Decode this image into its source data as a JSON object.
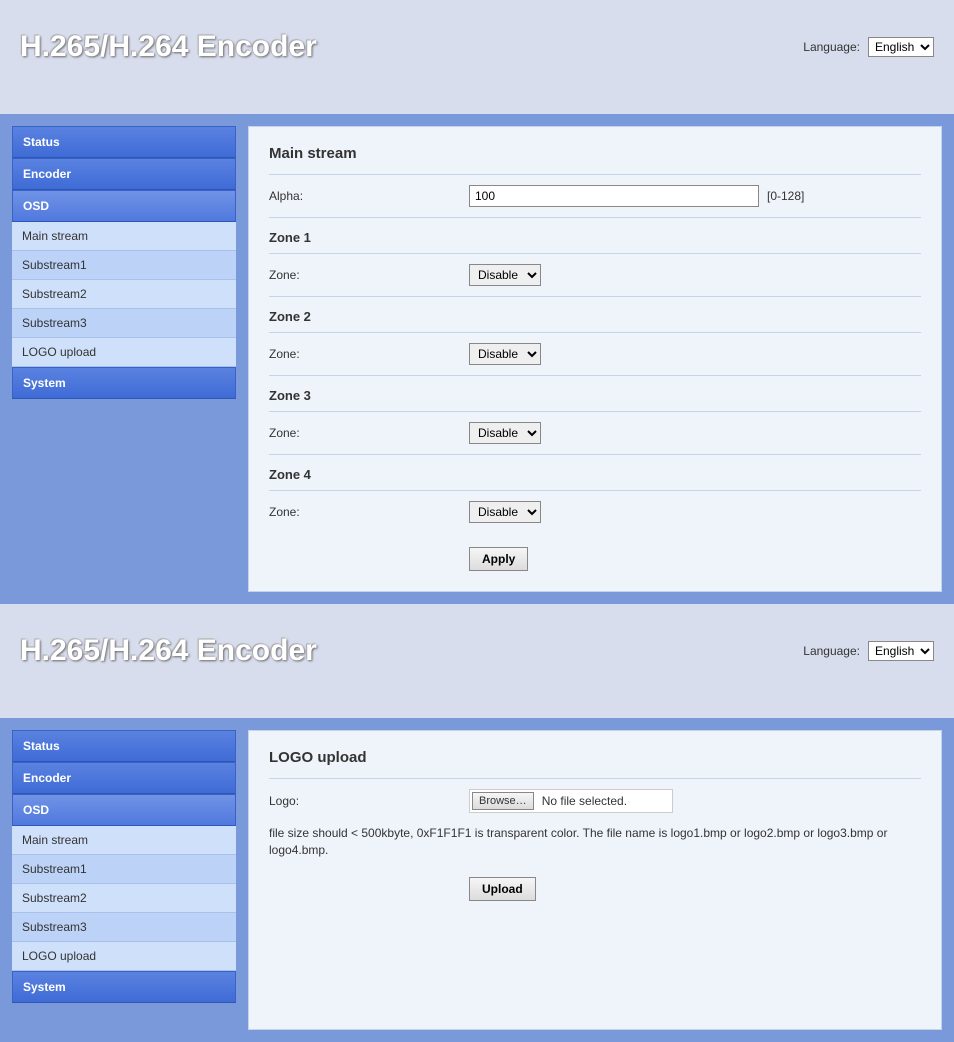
{
  "header": {
    "title": "H.265/H.264 Encoder",
    "language_label": "Language:",
    "language_value": "English"
  },
  "sidebar": {
    "items": [
      {
        "label": "Status",
        "type": "cat"
      },
      {
        "label": "Encoder",
        "type": "cat"
      },
      {
        "label": "OSD",
        "type": "cat_active"
      },
      {
        "label": "Main stream",
        "type": "sub"
      },
      {
        "label": "Substream1",
        "type": "sub"
      },
      {
        "label": "Substream2",
        "type": "sub"
      },
      {
        "label": "Substream3",
        "type": "sub"
      },
      {
        "label": "LOGO upload",
        "type": "sub"
      },
      {
        "label": "System",
        "type": "cat"
      }
    ]
  },
  "panel1": {
    "title": "Main stream",
    "alpha_label": "Alpha:",
    "alpha_value": "100",
    "alpha_hint": "[0-128]",
    "zones": [
      {
        "title": "Zone 1",
        "label": "Zone:",
        "value": "Disable"
      },
      {
        "title": "Zone 2",
        "label": "Zone:",
        "value": "Disable"
      },
      {
        "title": "Zone 3",
        "label": "Zone:",
        "value": "Disable"
      },
      {
        "title": "Zone 4",
        "label": "Zone:",
        "value": "Disable"
      }
    ],
    "apply_label": "Apply"
  },
  "panel2": {
    "title": "LOGO upload",
    "logo_label": "Logo:",
    "browse_label": "Browse…",
    "file_status": "No file selected.",
    "note": "file size should < 500kbyte, 0xF1F1F1 is transparent color. The file name is logo1.bmp or logo2.bmp or logo3.bmp or logo4.bmp.",
    "upload_label": "Upload"
  }
}
